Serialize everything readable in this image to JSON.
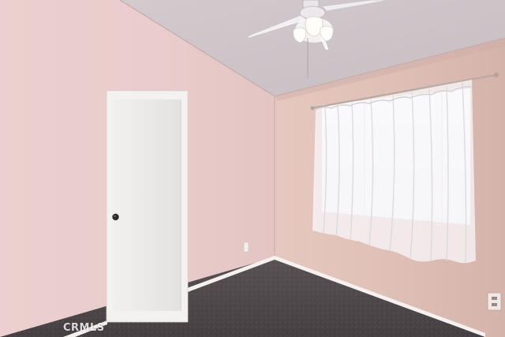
{
  "photo": {
    "watermark": "CRMLS"
  },
  "colors": {
    "left_wall": "#e8cccb",
    "right_wall": "#dfc0b7",
    "ceiling": "#cdc5c8",
    "carpet": "#4f4749",
    "door": "#ecebea",
    "trim": "#f3f1ef",
    "curtain": "#f4f3f5"
  }
}
